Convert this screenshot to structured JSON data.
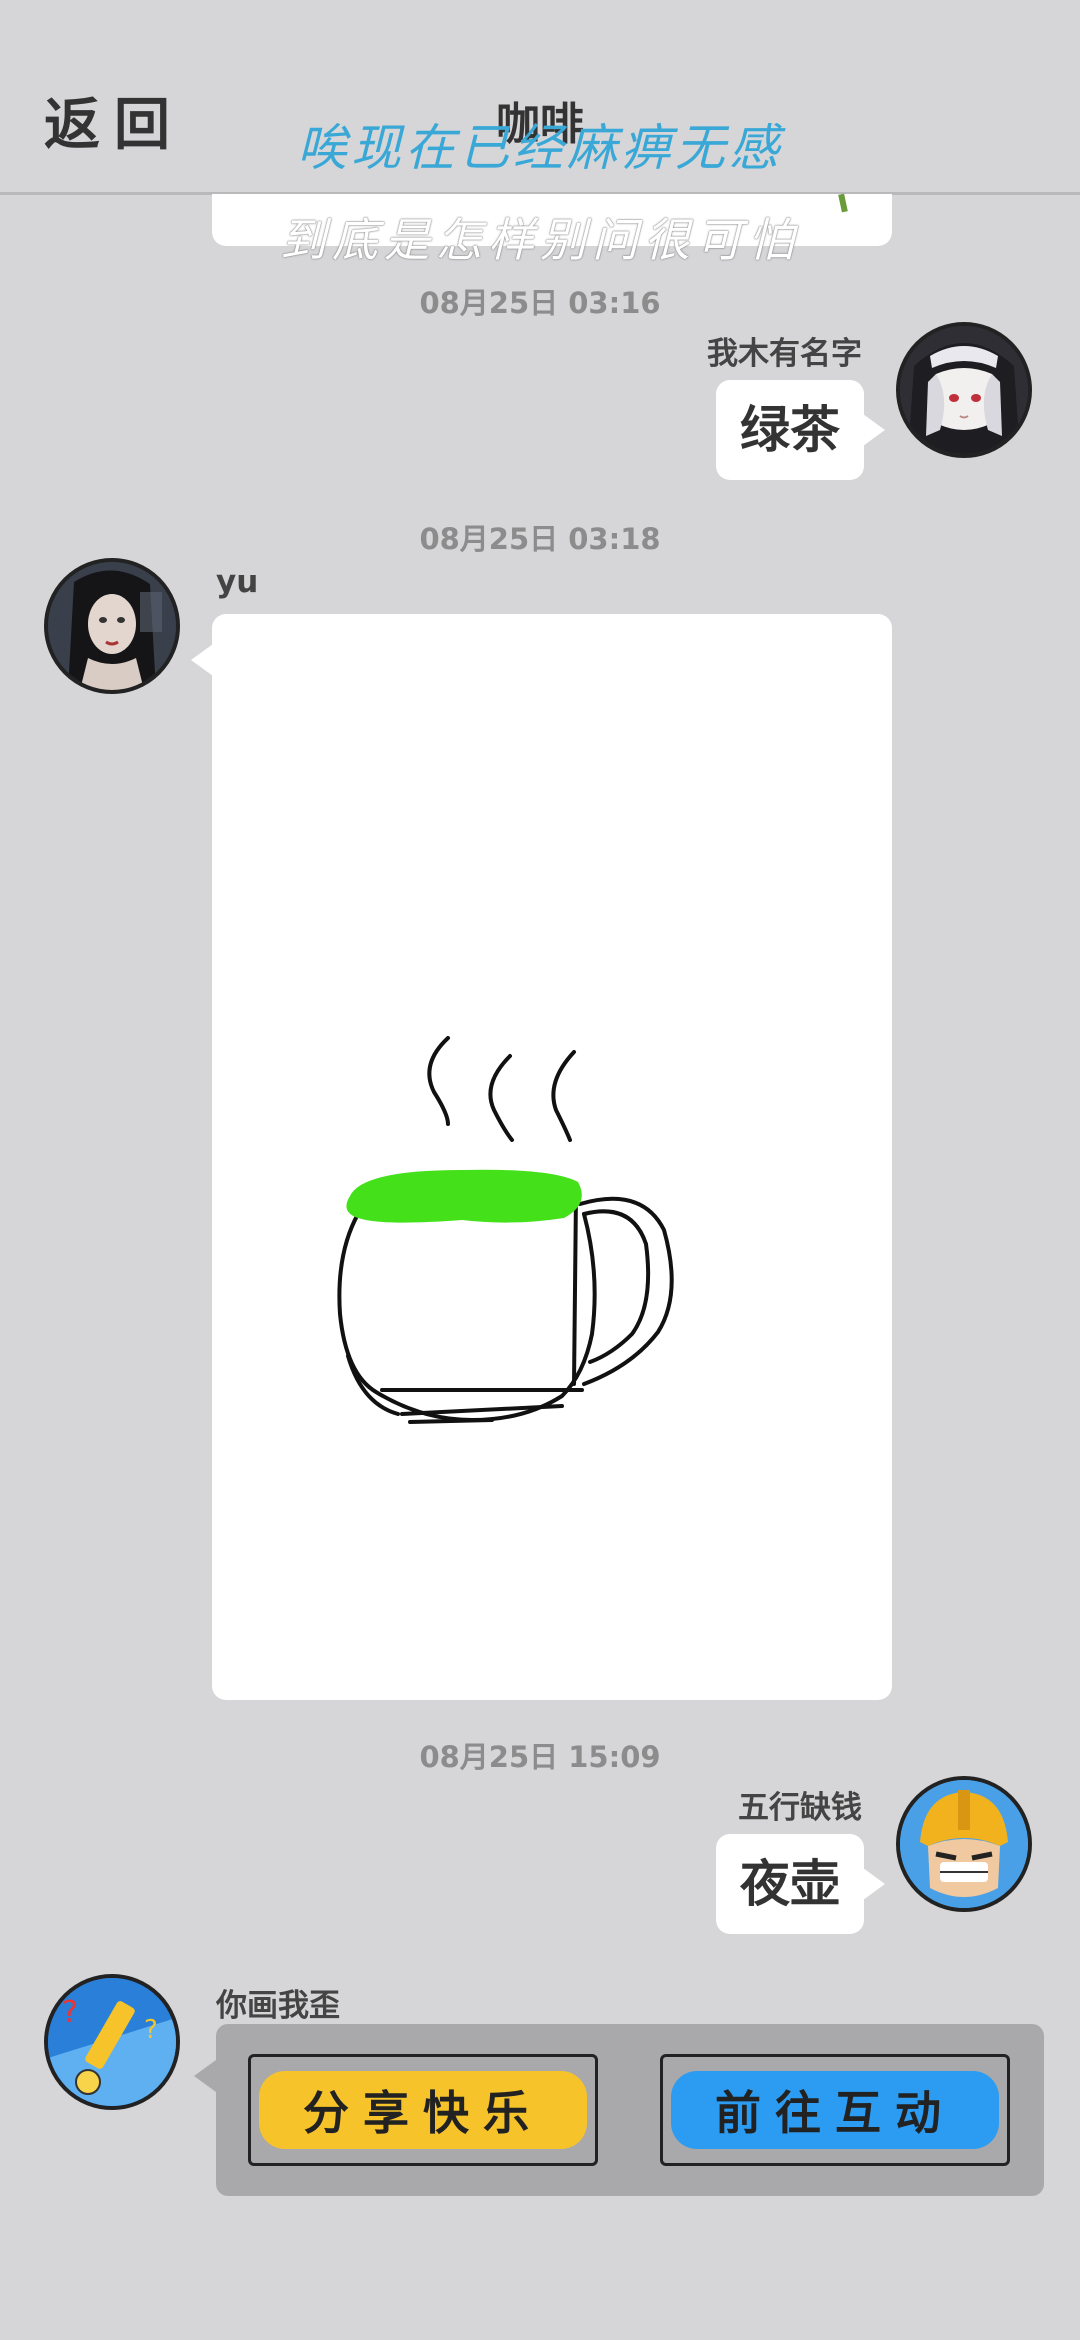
{
  "header": {
    "back_label": "返回",
    "title": "咖啡",
    "lyric_line1": "唉现在已经麻痹无感",
    "lyric_line2": "到底是怎样别问很可怕"
  },
  "messages": [
    {
      "timestamp": "08月25日  03:16",
      "username": "我木有名字",
      "text": "绿茶",
      "side": "right",
      "avatar": "anime-nun-girl-avatar"
    },
    {
      "timestamp": "08月25日  03:18",
      "username": "yu",
      "type": "drawing",
      "drawing": "coffee-cup-sketch",
      "side": "left",
      "avatar": "dark-haired-woman-avatar"
    },
    {
      "timestamp": "08月25日  15:09",
      "username": "五行缺钱",
      "text": "夜壶",
      "side": "right",
      "avatar": "clash-barbarian-avatar"
    }
  ],
  "game_card": {
    "username": "你画我歪",
    "avatar": "pencil-mascot-avatar",
    "share_label": "分享快乐",
    "interact_label": "前往互动",
    "share_color": "#f6c32a",
    "interact_color": "#2b9cf2"
  },
  "colors": {
    "background": "#d6d6d8",
    "cup_liquid": "#44e01a",
    "lyric_blue": "#3aa8d6"
  }
}
